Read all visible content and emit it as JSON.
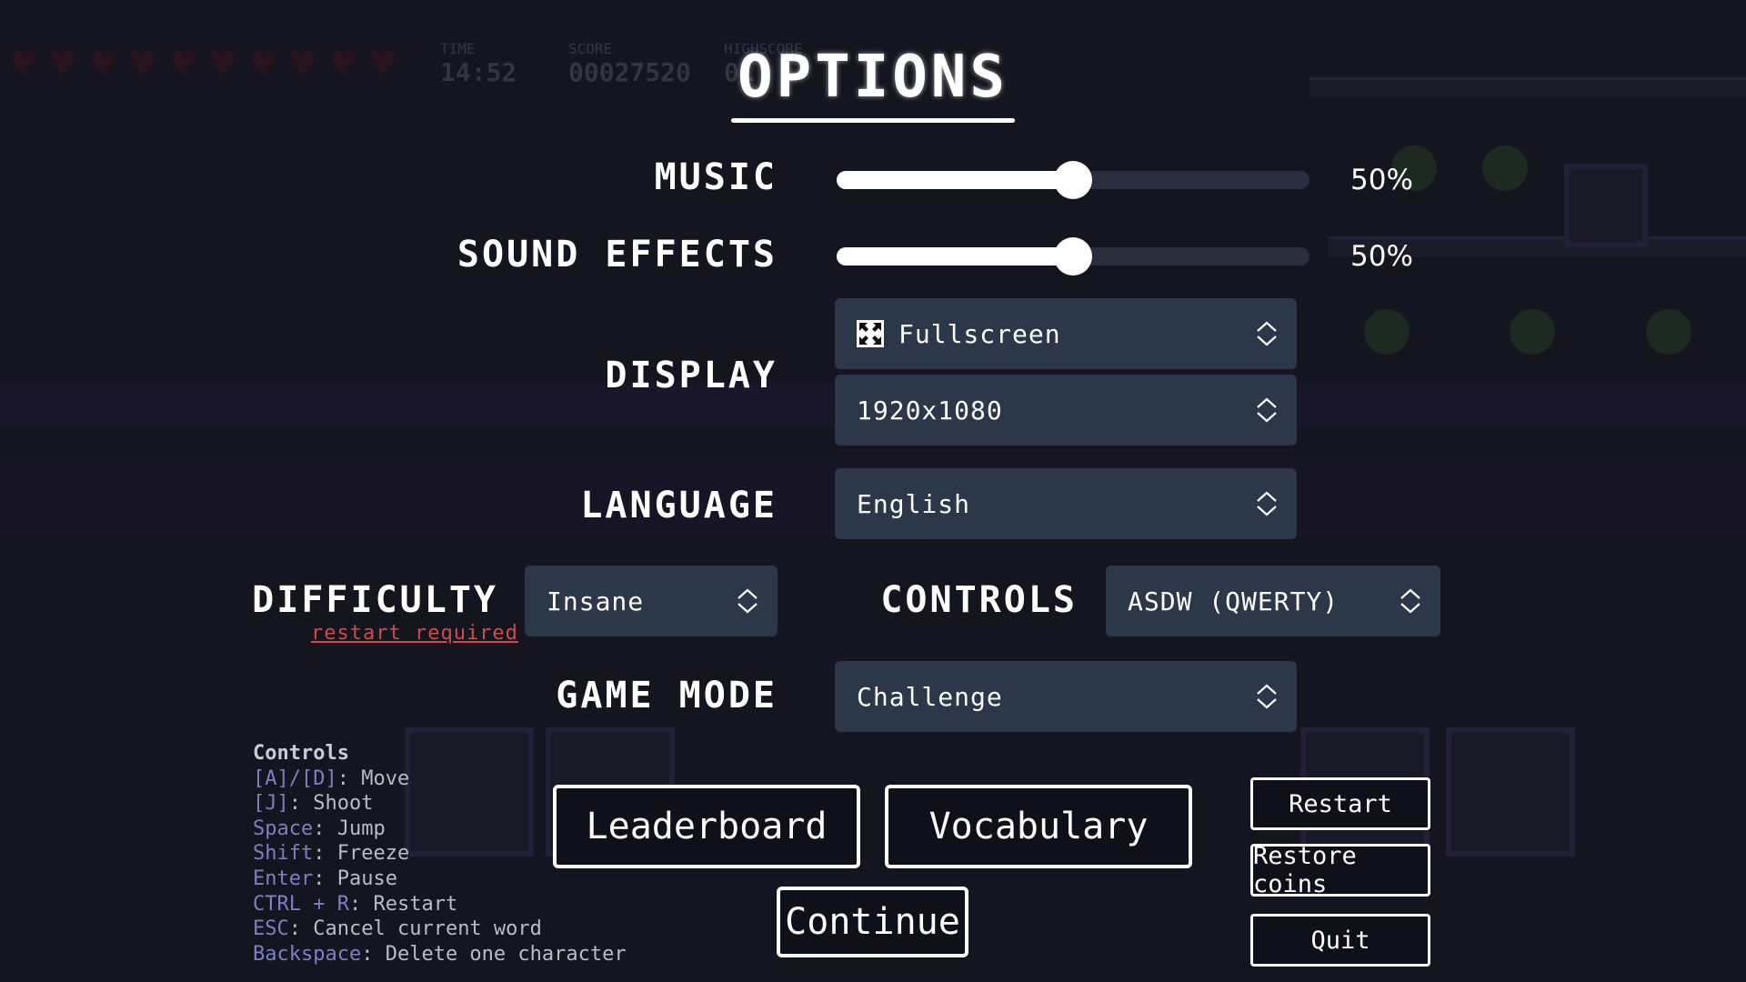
{
  "title": "OPTIONS",
  "hud": {
    "time_label": "TIME",
    "time_value": "14:52",
    "score_label": "SCORE",
    "score_value": "00027520",
    "highscore_label": "HIGHSCORE",
    "highscore_value": "01",
    "hearts": 10
  },
  "music": {
    "label": "MUSIC",
    "value": 50,
    "display": "50%"
  },
  "sound_effects": {
    "label": "SOUND EFFECTS",
    "value": 50,
    "display": "50%"
  },
  "display": {
    "label": "DISPLAY",
    "mode": "Fullscreen",
    "resolution": "1920x1080"
  },
  "language": {
    "label": "LANGUAGE",
    "value": "English"
  },
  "difficulty": {
    "label": "DIFFICULTY",
    "value": "Insane",
    "note": "restart required"
  },
  "controls": {
    "label": "CONTROLS",
    "value": "ASDW (QWERTY)"
  },
  "game_mode": {
    "label": "GAME MODE",
    "value": "Challenge"
  },
  "help": {
    "heading": "Controls",
    "lines": [
      {
        "key": "[A]/[D]",
        "action": "Move"
      },
      {
        "key": "[J]",
        "action": "Shoot"
      },
      {
        "key": "Space",
        "action": "Jump"
      },
      {
        "key": "Shift",
        "action": "Freeze"
      },
      {
        "key": "Enter",
        "action": "Pause"
      },
      {
        "key": "CTRL + R",
        "action": "Restart"
      },
      {
        "key": "ESC",
        "action": "Cancel current word"
      },
      {
        "key": "Backspace",
        "action": "Delete one character"
      }
    ]
  },
  "buttons": {
    "leaderboard": "Leaderboard",
    "vocabulary": "Vocabulary",
    "continue": "Continue",
    "restart": "Restart",
    "restore_coins": "Restore coins",
    "quit": "Quit"
  },
  "colors": {
    "background": "#14151f",
    "select_bg": "#2c374a",
    "warning": "#d14a4a",
    "key_highlight": "#7d7fc4"
  }
}
